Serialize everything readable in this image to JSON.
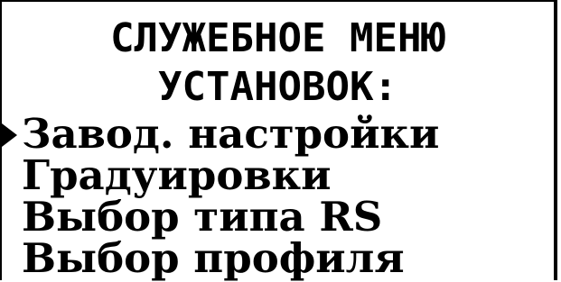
{
  "screen": {
    "title_line_1": "СЛУЖЕБНОЕ МЕНЮ",
    "title_line_2": "УСТАНОВОК:"
  },
  "menu": {
    "selected_index": 0,
    "cursor_icon": "selection-arrow-icon",
    "items": [
      {
        "label": "Завод. настройки"
      },
      {
        "label": "Градуировки"
      },
      {
        "label": "Выбор типа RS"
      },
      {
        "label": "Выбор профиля"
      }
    ]
  },
  "colors": {
    "background": "#ffffff",
    "foreground": "#000000"
  }
}
